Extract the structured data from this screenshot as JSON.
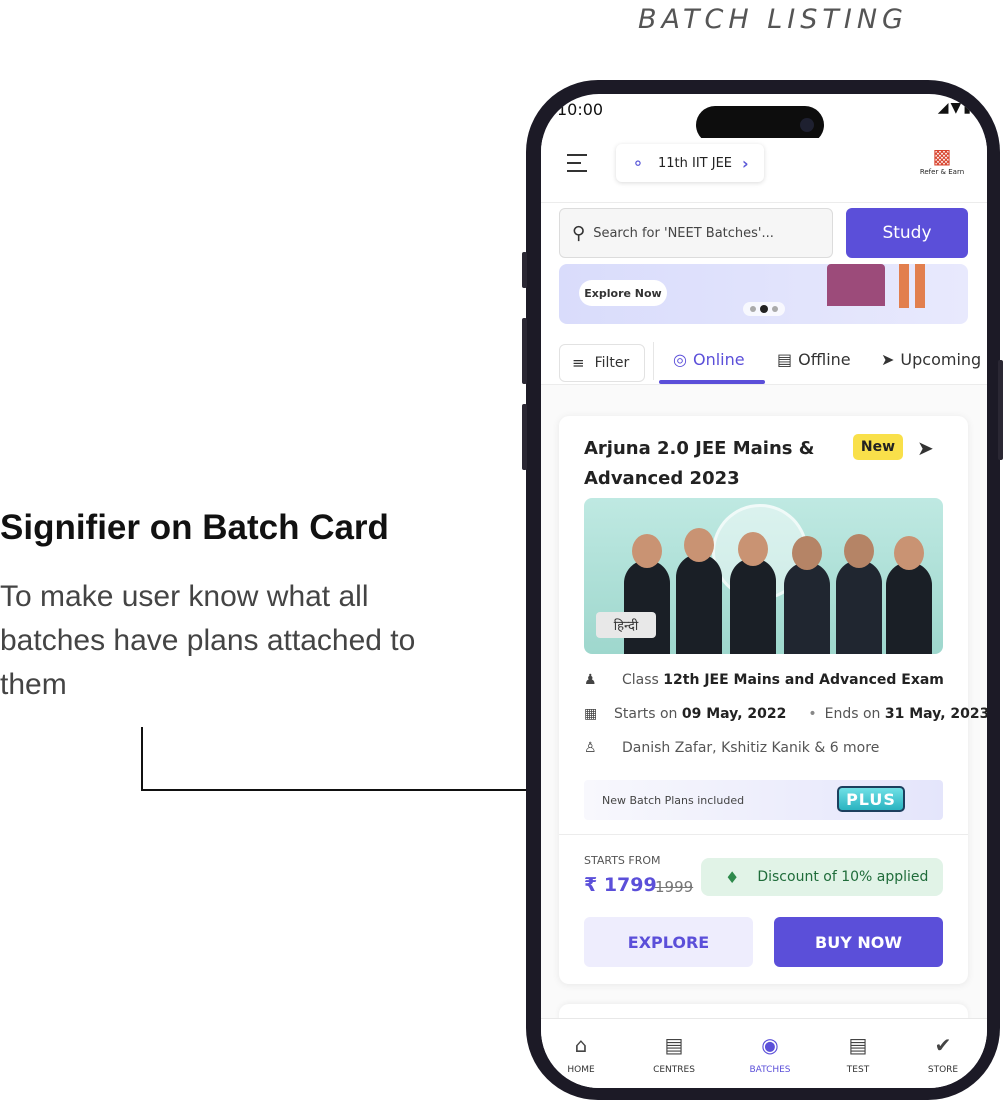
{
  "page": {
    "section_heading": "BATCH LISTING"
  },
  "annotation": {
    "title": "Signifier on Batch Card",
    "description": "To make user know what all batches have plans attached to them"
  },
  "status_bar": {
    "time": "10:00",
    "icons": "◢▼▮"
  },
  "header": {
    "menu_icon": "hamburger-menu-icon",
    "course_selector": "11th IIT JEE",
    "course_icon": "globe-icon",
    "refer_label": "Refer & Earn",
    "refer_icon": "gift-icon"
  },
  "search": {
    "placeholder": "Search for 'NEET Batches'...",
    "study_button": "Study"
  },
  "banner": {
    "cta": "Explore Now",
    "slides": 3,
    "active_slide": 2
  },
  "tabs": {
    "filter_label": "Filter",
    "items": [
      {
        "label": "Online",
        "icon": "globe-icon",
        "active": true
      },
      {
        "label": "Offline",
        "icon": "building-icon",
        "active": false
      },
      {
        "label": "Upcoming",
        "icon": "rocket-icon",
        "active": false
      }
    ]
  },
  "batch_card": {
    "title": "Arjuna 2.0 JEE Mains & Advanced 2023",
    "badge": "New",
    "language_tag": "हिन्दी",
    "class_prefix": "Class",
    "class_value": "12th JEE Mains and Advanced Exam",
    "starts_prefix": "Starts on",
    "starts_date": "09 May, 2022",
    "ends_prefix": "Ends on",
    "ends_date": "31 May, 2023",
    "teachers": "Danish Zafar, Kshitiz Kanik & 6 more",
    "plans_text": "New Batch Plans included",
    "plus_badge": "PLUS",
    "starts_from_label": "STARTS FROM",
    "price": "₹ 1799",
    "old_price": "1999",
    "discount_text": "Discount of 10% applied",
    "explore_button": "EXPLORE",
    "buy_button": "BUY NOW"
  },
  "bottom_nav": {
    "items": [
      {
        "label": "HOME",
        "icon": "home-icon",
        "active": false
      },
      {
        "label": "CENTRES",
        "icon": "building-icon",
        "active": false
      },
      {
        "label": "BATCHES",
        "icon": "batches-icon",
        "active": true
      },
      {
        "label": "TEST",
        "icon": "test-icon",
        "active": false
      },
      {
        "label": "STORE",
        "icon": "cart-icon",
        "active": false
      }
    ]
  },
  "colors": {
    "accent": "#5b4fd9",
    "new_badge": "#f9e04a",
    "discount_bg": "#e1f3e7",
    "discount_text": "#1f6c3a"
  }
}
